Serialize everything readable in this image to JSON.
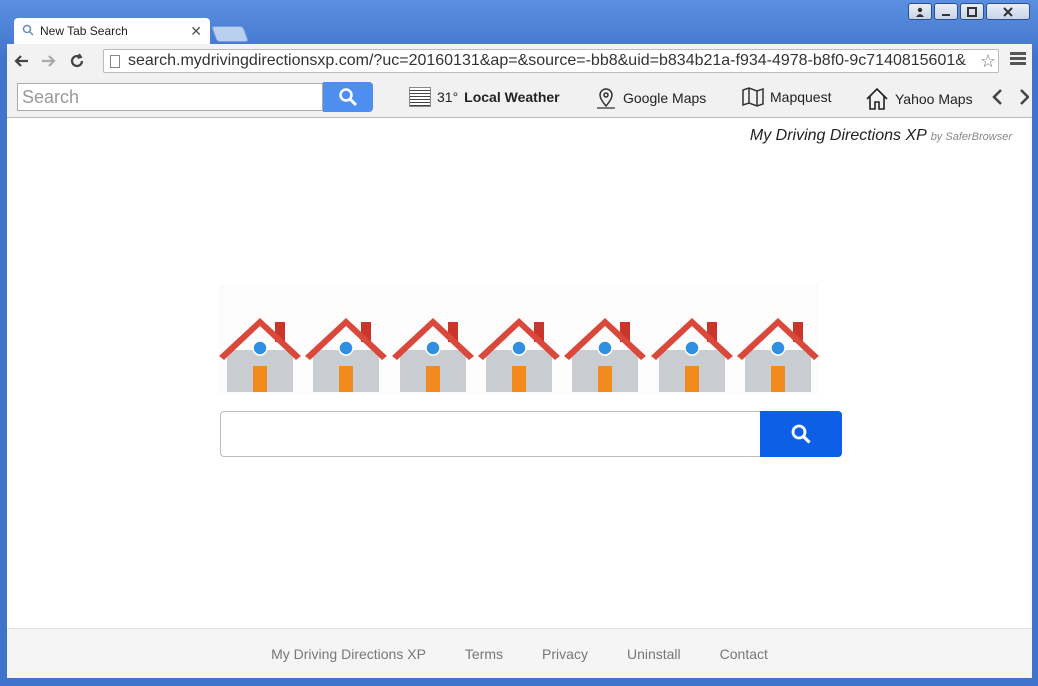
{
  "browser": {
    "tab_title": "New Tab Search",
    "url": "search.mydrivingdirectionsxp.com/?uc=20160131&ap=&source=-bb8&uid=b834b21a-f934-4978-b8f0-9c7140815601&"
  },
  "bookmarks": {
    "search_placeholder": "Search",
    "weather_temp": "31°",
    "weather_label": "Local Weather",
    "google_maps": "Google Maps",
    "mapquest": "Mapquest",
    "yahoo_maps": "Yahoo Maps"
  },
  "header": {
    "brand": "My Driving Directions XP",
    "by": "by SaferBrowser"
  },
  "footer": {
    "links": [
      "My Driving Directions XP",
      "Terms",
      "Privacy",
      "Uninstall",
      "Contact"
    ]
  },
  "colors": {
    "accent_blue": "#0d5fe8",
    "toolbar_blue": "#4d8ef0",
    "house_roof": "#d9483b",
    "house_wall": "#c9ccd1"
  }
}
